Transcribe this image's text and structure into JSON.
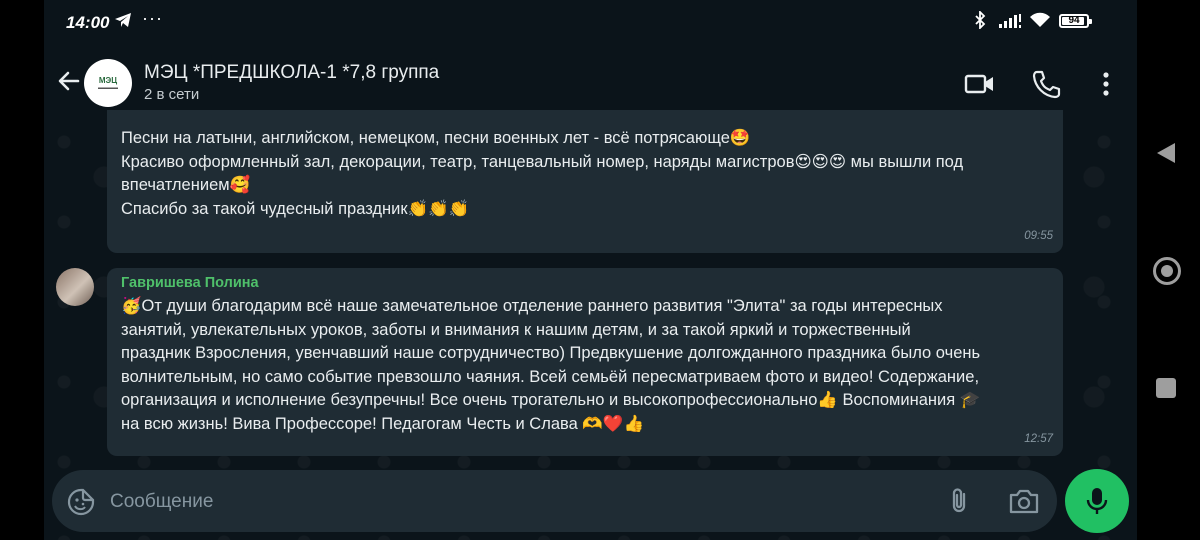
{
  "status_bar": {
    "time": "14:00",
    "telegram_icon": "telegram-icon",
    "more_icon": "more-dots-icon",
    "bluetooth_icon": "bluetooth-icon",
    "signal_icon": "signal-icon",
    "wifi_icon": "wifi-icon",
    "battery": "94",
    "battery_level": 0.94
  },
  "header": {
    "back_icon": "back-arrow-icon",
    "avatar_logo": "МЭЦ",
    "title": "МЭЦ *ПРЕДШКОЛА-1 *7,8 группа",
    "subtitle": "2 в сети",
    "video_icon": "video-call-icon",
    "call_icon": "phone-call-icon",
    "menu_icon": "kebab-menu-icon"
  },
  "messages": [
    {
      "lines": [
        "Песни на латыни, английском, немецком, песни военных лет - всё потрясающе🤩",
        "Красиво оформленный зал, декорации, театр, танцевальный номер, наряды магистров😍😍😍 мы вышли под",
        "впечатлением🥰",
        "Спасибо за такой чудесный праздник👏👏👏"
      ],
      "time": "09:55"
    },
    {
      "sender": "Гавришева Полина",
      "lines": [
        "🥳От души благодарим всё наше замечательное отделение раннего развития \"Элита\" за годы интересных",
        "занятий, увлекательных уроков, заботы и внимания к нашим детям, и за такой яркий и торжественный",
        "праздник Взросления, увенчавший наше сотрудничество) Предвкушение долгожданного праздника было очень",
        "волнительным, но само событие превзошло чаяния. Всей семьёй пересматриваем фото и видео! Содержание,",
        "организация и исполнение безупречны! Все очень трогательно и высокопрофессионально👍 Воспоминания 🎓",
        "на всю жизнь! Вива Профессоре! Педагогам Честь и Слава 🫶❤️👍"
      ],
      "time": "12:57"
    }
  ],
  "input_bar": {
    "placeholder": "Сообщение",
    "sticker_icon": "sticker-icon",
    "attach_icon": "paperclip-icon",
    "camera_icon": "camera-icon",
    "mic_icon": "microphone-icon"
  },
  "colors": {
    "background": "#0b141a",
    "bubble": "#1f2c34",
    "accent": "#21c063",
    "sender_name": "#4fc06a",
    "timestamp": "#8696a0"
  }
}
